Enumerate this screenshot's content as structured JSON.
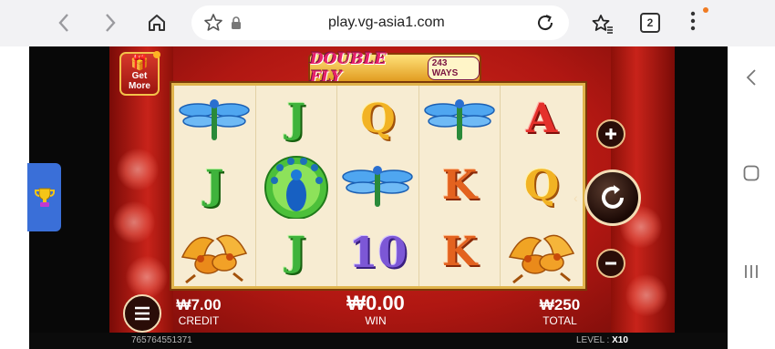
{
  "browser": {
    "url": "play.vg-asia1.com",
    "tab_count": "2",
    "back_icon": "chevron-left-icon",
    "forward_icon": "chevron-right-icon",
    "home_icon": "home-icon",
    "star_icon": "star-outline-icon",
    "lock_icon": "lock-icon",
    "reload_icon": "reload-icon",
    "bookmarks_icon": "bookmark-star-icon",
    "menu_icon": "more-vert-icon"
  },
  "game": {
    "title": "DOUBLE FLY",
    "ways": "243 WAYS",
    "get_more": [
      "Get",
      "More"
    ],
    "reels": [
      [
        "dragonfly",
        "J",
        "Q",
        "dragonfly",
        "A"
      ],
      [
        "J",
        "peacock",
        "dragonfly",
        "K",
        "Q"
      ],
      [
        "birds",
        "J",
        "10",
        "K",
        "birds"
      ]
    ],
    "credit": {
      "value": "₩7.00",
      "label": "CREDIT"
    },
    "win": {
      "value": "₩0.00",
      "label": "WIN"
    },
    "total": {
      "value": "₩250",
      "label": "TOTAL"
    },
    "session_id": "765764551371",
    "level_label": "LEVEL :",
    "level_value": "X10"
  },
  "colors": {
    "stage_red": "#c8231a",
    "reel_bg": "#f7ecd2",
    "gold": "#e0b44c",
    "trophy_tab": "#3a6fd8"
  }
}
